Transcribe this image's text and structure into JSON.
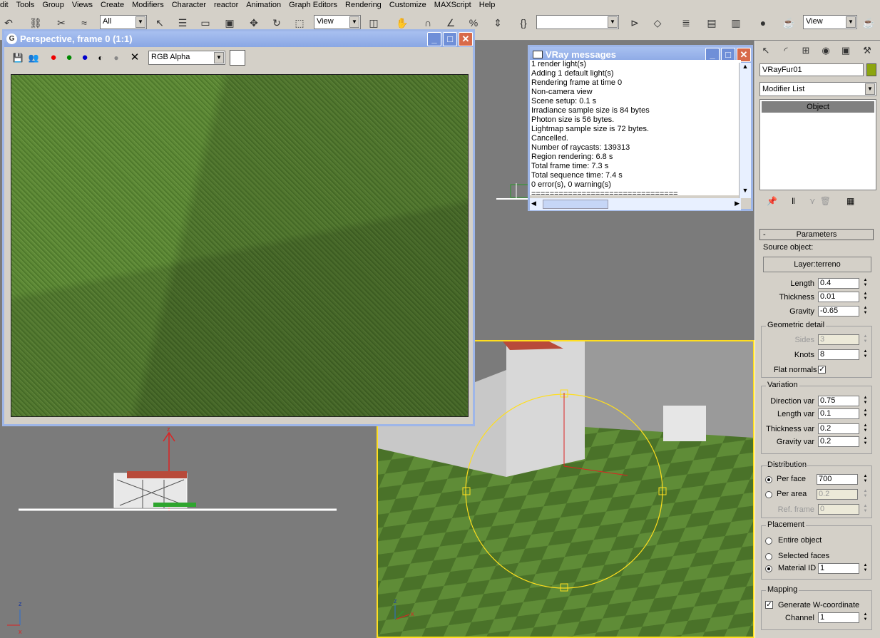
{
  "menu": [
    "dit",
    "Tools",
    "Group",
    "Views",
    "Create",
    "Modifiers",
    "Character",
    "reactor",
    "Animation",
    "Graph Editors",
    "Rendering",
    "Customize",
    "MAXScript",
    "Help"
  ],
  "toolbar": {
    "selection_filter": "All",
    "ref_coord": "View",
    "render_view": "View"
  },
  "vfb": {
    "title": "Perspective, frame 0 (1:1)",
    "channel": "RGB Alpha"
  },
  "vray": {
    "title": "VRay messages",
    "lines": [
      "1 render light(s)",
      "Adding 1 default light(s)",
      "Rendering frame at time 0",
      "Non-camera view",
      "Scene setup: 0.1 s",
      "Irradiance sample size is 84 bytes",
      "Photon size is 56 bytes.",
      "Lightmap sample size is 72 bytes.",
      "Cancelled.",
      "Number of raycasts: 139313",
      "Region rendering: 6.8 s",
      "Total frame time: 7.3 s",
      "Total sequence time: 7.4 s",
      "0 error(s), 0 warning(s)",
      "================================"
    ]
  },
  "panel": {
    "object_name": "VRayFur01",
    "modifier_list": "Modifier List",
    "stack_item": "Object",
    "rollout": "Parameters",
    "source_label": "Source object:",
    "source_button": "Layer:terreno",
    "length_label": "Length",
    "length": "0.4",
    "thickness_label": "Thickness",
    "thickness": "0.01",
    "gravity_label": "Gravity",
    "gravity": "-0.65",
    "geo_title": "Geometric detail",
    "sides_label": "Sides",
    "sides": "3",
    "knots_label": "Knots",
    "knots": "8",
    "flat_label": "Flat normals",
    "var_title": "Variation",
    "dirvar_label": "Direction var",
    "dirvar": "0.75",
    "lenvar_label": "Length var",
    "lenvar": "0.1",
    "thkvar_label": "Thickness var",
    "thkvar": "0.2",
    "gravar_label": "Gravity var",
    "gravar": "0.2",
    "dist_title": "Distribution",
    "perface_label": "Per face",
    "perface": "700",
    "perarea_label": "Per area",
    "perarea": "0.2",
    "refframe_label": "Ref. frame",
    "refframe": "0",
    "place_title": "Placement",
    "entire_label": "Entire object",
    "selected_label": "Selected faces",
    "matid_label": "Material ID",
    "matid": "1",
    "map_title": "Mapping",
    "genw_label": "Generate W-coordinate",
    "channel_label": "Channel",
    "channel": "1"
  },
  "axes": {
    "z": "z",
    "x": "x"
  }
}
